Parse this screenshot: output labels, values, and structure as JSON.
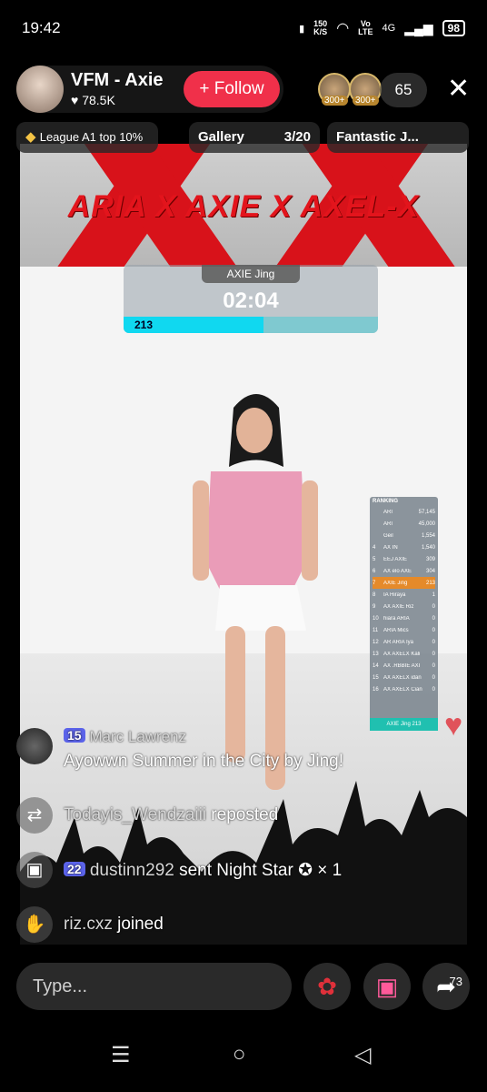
{
  "status": {
    "time": "19:42",
    "speed_top": "150",
    "speed_bottom": "K/S",
    "volte_top": "Vo",
    "volte_bottom": "LTE",
    "network": "4G",
    "battery": "98"
  },
  "header": {
    "name": "VFM - Axie",
    "likes": "♥ 78.5K",
    "follow_label": "+ Follow",
    "viewer_badge": "300+",
    "viewer_count": "65",
    "close": "✕"
  },
  "pills": {
    "league": "League A1 top 10%",
    "gallery": "Gallery",
    "gallery_count": "3/20",
    "fantastic": "Fantastic J..."
  },
  "stream": {
    "banner_title": "ARIA X AXIE X AXEL-X",
    "timer_name": "AXIE Jing",
    "timer_clock": "02:04",
    "progress_value": "213",
    "progress_fraction": 0.55
  },
  "ranking": {
    "title": "RANKING",
    "rows": [
      {
        "n": "",
        "name": "ARI",
        "score": "57,145"
      },
      {
        "n": "",
        "name": "ARI",
        "score": "45,000"
      },
      {
        "n": "",
        "name": "Geil",
        "score": "1,554"
      },
      {
        "n": "4",
        "name": "AX IN",
        "score": "1,540"
      },
      {
        "n": "5",
        "name": "EEJ AXIE",
        "score": "309"
      },
      {
        "n": "6",
        "name": "AX elo AXE",
        "score": "304"
      },
      {
        "n": "7",
        "name": "AXIE Jing",
        "score": "213"
      },
      {
        "n": "8",
        "name": "IA Hiraya",
        "score": "1"
      },
      {
        "n": "9",
        "name": "AX AXIE Riz",
        "score": "0"
      },
      {
        "n": "10",
        "name": "hiara ARIA",
        "score": "0"
      },
      {
        "n": "11",
        "name": "ARIA Mics",
        "score": "0"
      },
      {
        "n": "12",
        "name": "AR ARIA Iya",
        "score": "0"
      },
      {
        "n": "13",
        "name": "AX AXELX Kali",
        "score": "0"
      },
      {
        "n": "14",
        "name": "AX .RBBIE AXI",
        "score": "0"
      },
      {
        "n": "15",
        "name": "AX AXELX idan",
        "score": "0"
      },
      {
        "n": "16",
        "name": "AX AXELX Cian",
        "score": "0"
      }
    ],
    "me": "AXIE Jing 213"
  },
  "chat": [
    {
      "badge": "15",
      "user": "Marc Lawrenz",
      "text": "Ayowwn Summer in the City by Jing!"
    },
    {
      "user": "Todayis_Wendzaiii",
      "text": "reposted"
    },
    {
      "badge": "22",
      "user": "dustinn292",
      "text": "sent Night Star",
      "extra": "× 1"
    },
    {
      "user": "riz.cxz",
      "text": "joined"
    }
  ],
  "bottom": {
    "placeholder": "Type...",
    "share_count": "73"
  },
  "icons": {
    "rose": "rose-icon",
    "gift": "gift-icon",
    "share": "share-icon"
  },
  "colors": {
    "follow": "#f0304a",
    "badge": "#5b63ea",
    "progress": "#10d8f0"
  }
}
